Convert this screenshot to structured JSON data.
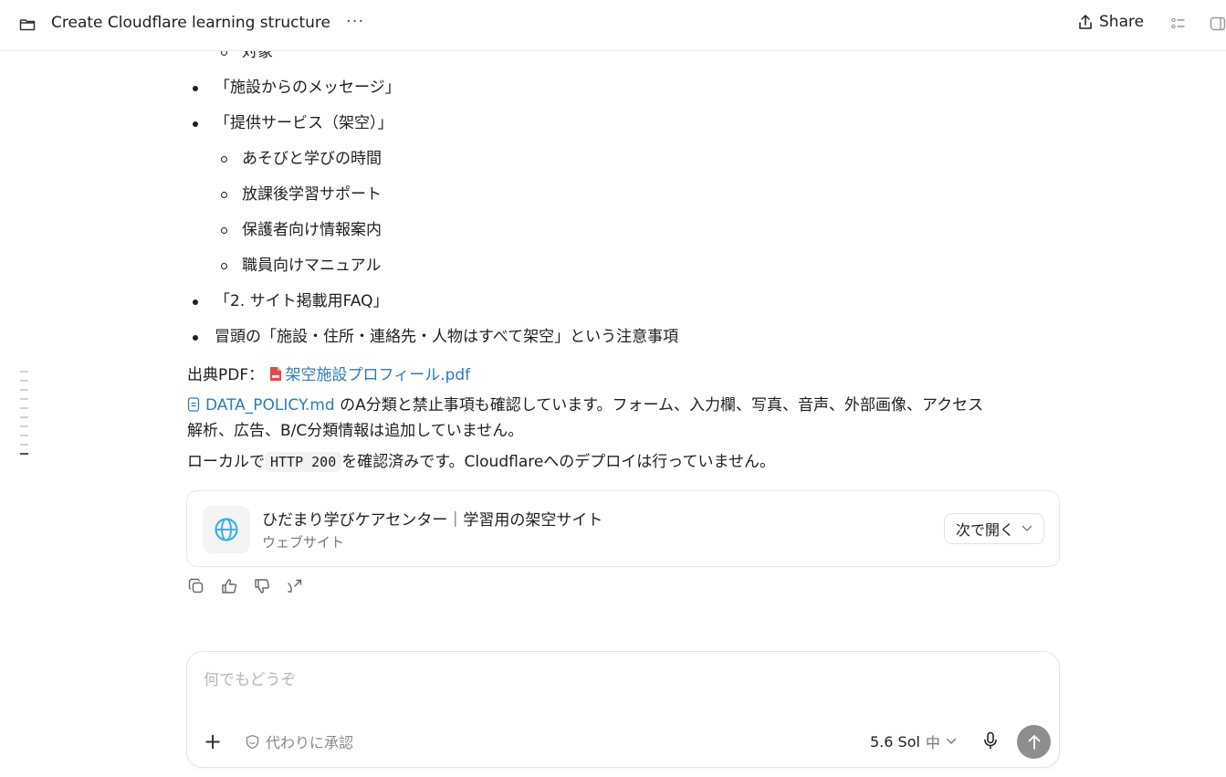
{
  "header": {
    "title": "Create Cloudflare learning structure",
    "more": "···",
    "share_label": "Share"
  },
  "message": {
    "list": [
      {
        "level": 2,
        "text": "対象"
      },
      {
        "level": 1,
        "text": "「施設からのメッセージ」"
      },
      {
        "level": 1,
        "text": "「提供サービス（架空）」"
      },
      {
        "level": 2,
        "text": "あそびと学びの時間"
      },
      {
        "level": 2,
        "text": "放課後学習サポート"
      },
      {
        "level": 2,
        "text": "保護者向け情報案内"
      },
      {
        "level": 2,
        "text": "職員向けマニュアル"
      },
      {
        "level": 1,
        "text": "「2. サイト掲載用FAQ」"
      },
      {
        "level": 1,
        "text": "冒頭の「施設・住所・連絡先・人物はすべて架空」という注意事項"
      }
    ],
    "source_label": "出典PDF：",
    "source_file": "架空施設プロフィール.pdf",
    "policy_file": "DATA_POLICY.md",
    "policy_text_1": " のA分類と禁止事項も確認しています。フォーム、入力欄、写真、音声、外部画像、アクセス",
    "policy_text_2": "解析、広告、B/C分類情報は追加していません。",
    "local_pre": "ローカルで",
    "local_code": "HTTP 200",
    "local_post": "を確認済みです。Cloudflareへのデプロイは行っていません。"
  },
  "card": {
    "title": "ひだまり学びケアセンター｜学習用の架空サイト",
    "subtitle": "ウェブサイト",
    "open_label": "次で開く"
  },
  "composer": {
    "placeholder": "何でもどうぞ",
    "approve_label": "代わりに承認",
    "model": "5.6 Sol",
    "level": "中"
  },
  "colors": {
    "link": "#2c7bbf",
    "pdf": "#e5484d",
    "send": "#8e8e8e"
  }
}
